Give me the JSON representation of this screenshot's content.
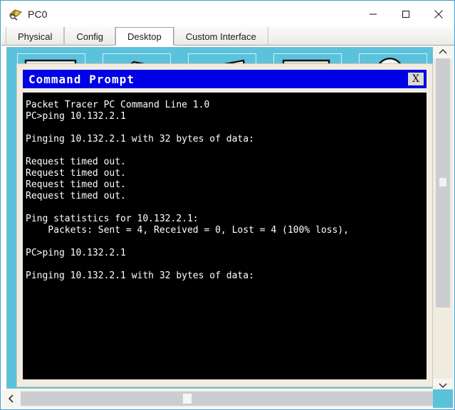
{
  "window": {
    "title": "PC0",
    "icon": "packet-tracer-icon",
    "controls": {
      "minimize": "minimize-icon",
      "maximize": "maximize-icon",
      "close": "close-icon"
    }
  },
  "tabs": [
    {
      "label": "Physical",
      "active": false
    },
    {
      "label": "Config",
      "active": false
    },
    {
      "label": "Desktop",
      "active": true
    },
    {
      "label": "Custom Interface",
      "active": false
    }
  ],
  "desktop": {
    "background_color": "#5bc2dc",
    "icons": [
      {
        "name": "ip-configuration-icon"
      },
      {
        "name": "dial-up-icon"
      },
      {
        "name": "terminal-icon"
      },
      {
        "name": "command-prompt-icon"
      },
      {
        "name": "web-browser-icon"
      }
    ]
  },
  "command_prompt": {
    "title": "Command Prompt",
    "title_bar_color": "#0000e6",
    "close_label": "X",
    "terminal_background": "#000000",
    "terminal_foreground": "#ffffff",
    "lines": [
      "Packet Tracer PC Command Line 1.0",
      "PC>ping 10.132.2.1",
      "",
      "Pinging 10.132.2.1 with 32 bytes of data:",
      "",
      "Request timed out.",
      "Request timed out.",
      "Request timed out.",
      "Request timed out.",
      "",
      "Ping statistics for 10.132.2.1:",
      "    Packets: Sent = 4, Received = 0, Lost = 4 (100% loss),",
      "",
      "PC>ping 10.132.2.1",
      "",
      "Pinging 10.132.2.1 with 32 bytes of data:"
    ]
  },
  "scrollbars": {
    "vertical": {
      "up_arrow": "chevron-up-icon",
      "down_arrow": "chevron-down-icon"
    },
    "horizontal": {
      "left_arrow": "chevron-left-icon",
      "right_arrow": "chevron-right-icon"
    }
  }
}
